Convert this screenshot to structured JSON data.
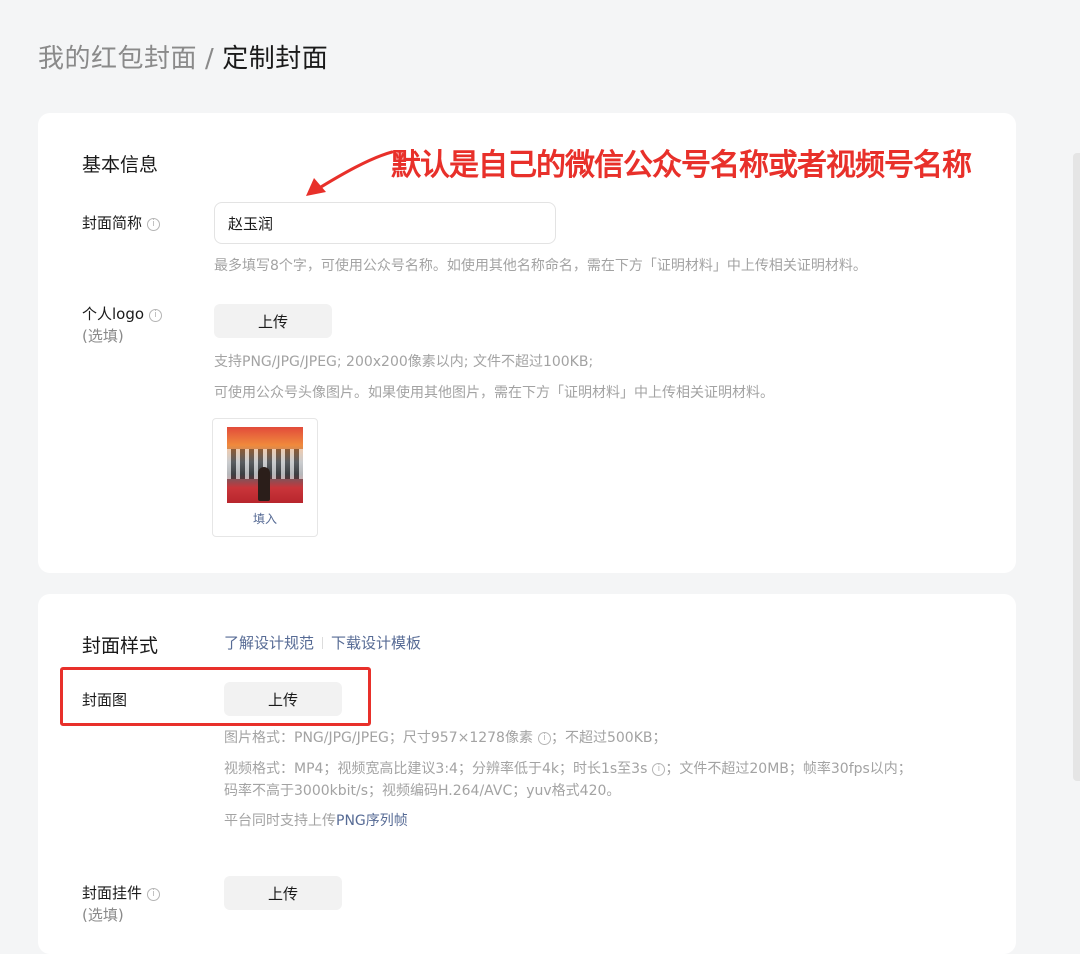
{
  "breadcrumb": {
    "parent": "我的红包封面",
    "separator": "/",
    "current": "定制封面"
  },
  "basic_info": {
    "title": "基本信息",
    "cover_name": {
      "label": "封面简称",
      "value": "赵玉润",
      "hint": "最多填写8个字，可使用公众号名称。如使用其他名称命名，需在下方「证明材料」中上传相关证明材料。"
    },
    "logo": {
      "label": "个人logo",
      "optional": "(选填)",
      "upload_label": "上传",
      "hint_1": "支持PNG/JPG/JPEG; 200x200像素以内; 文件不超过100KB;",
      "hint_2": "可使用公众号头像图片。如果使用其他图片，需在下方「证明材料」中上传相关证明材料。",
      "fill_label": "填入"
    }
  },
  "cover_style": {
    "title": "封面样式",
    "link_design_spec": "了解设计规范",
    "link_download_template": "下载设计模板",
    "cover_image": {
      "label": "封面图",
      "upload_label": "上传",
      "hint_image": "图片格式：PNG/JPG/JPEG；尺寸957×1278像素",
      "hint_image_tail": "；不超过500KB；",
      "hint_video_1a": "视频格式：MP4；视频宽高比建议3:4；分辨率低于4k；时长1s至3s",
      "hint_video_1b": "；文件不超过20MB；帧率30fps以内；",
      "hint_video_2": "码率不高于3000kbit/s；视频编码H.264/AVC；yuv格式420。",
      "hint_platform": "平台同时支持上传",
      "hint_platform_link": "PNG序列帧"
    },
    "pendant": {
      "label": "封面挂件",
      "optional": "(选填)",
      "upload_label": "上传"
    }
  },
  "annotation": {
    "text": "默认是自己的微信公众号名称或者视频号名称",
    "color": "#e8302a"
  },
  "colors": {
    "link": "#576b95",
    "hint": "#a3a3a3",
    "annotation": "#e8302a",
    "background": "#f4f5f6"
  },
  "icons": {
    "info": "info-circle-icon"
  }
}
